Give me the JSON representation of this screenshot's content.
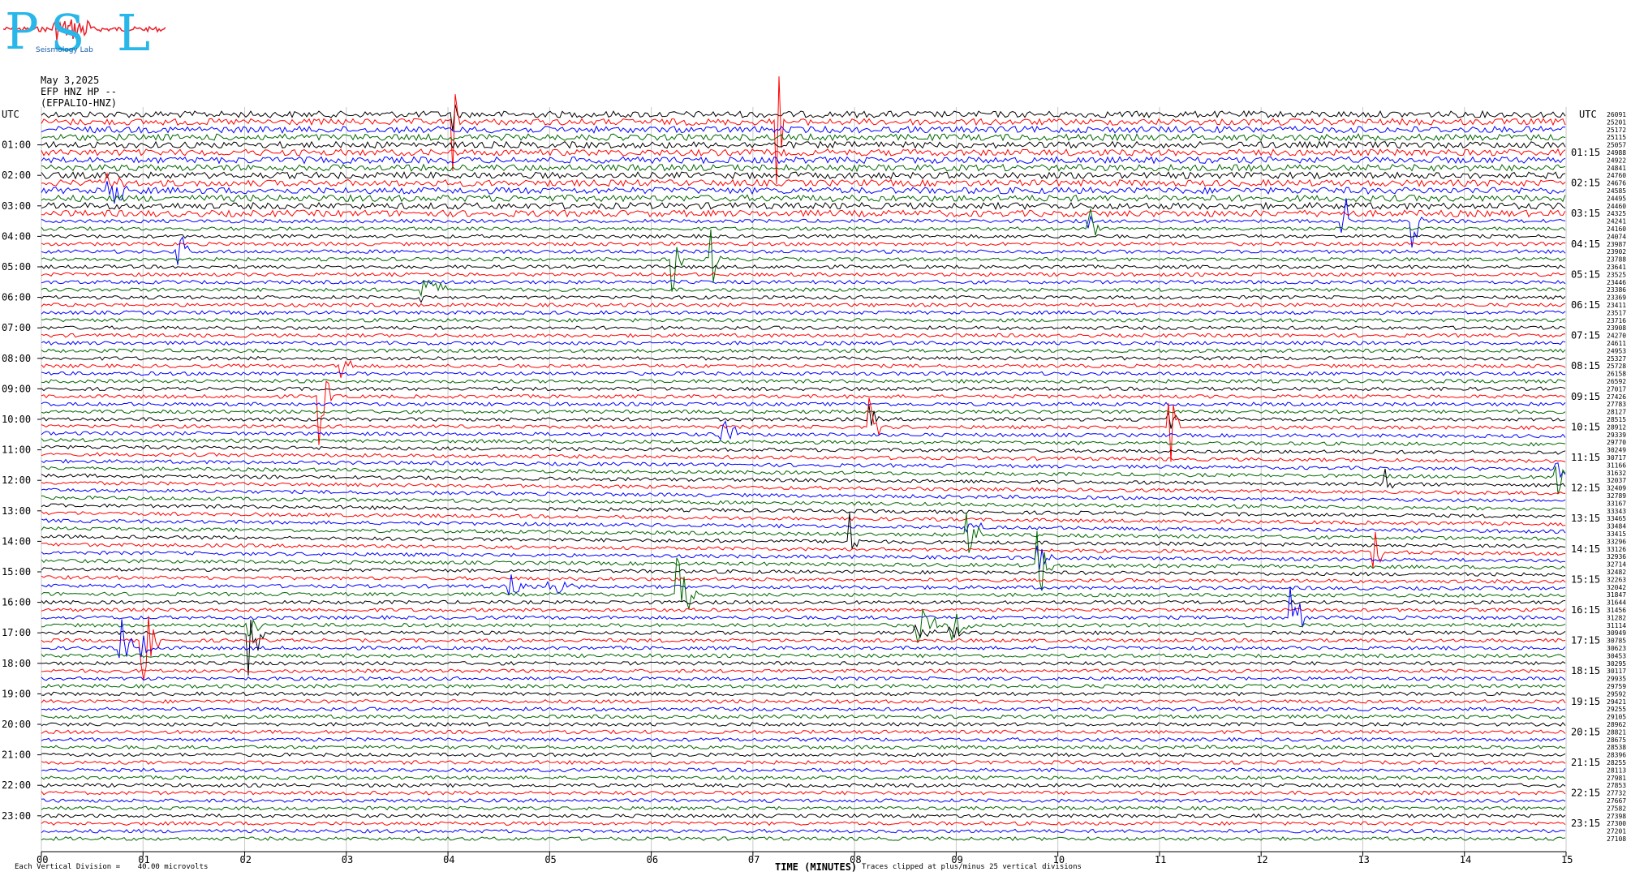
{
  "logo": {
    "letters": [
      "P",
      "S",
      "L"
    ],
    "tagline": "Seismology Lab",
    "letter_color": "#29b6e8",
    "accent_color": "#e8202a"
  },
  "header": {
    "date": "May 3,2025",
    "channel": "EFP HNZ HP --",
    "station": "(EFPALIO-HNZ)"
  },
  "footer": {
    "scale_note": "Each Vertical Division =    40.00 microvolts",
    "clip_note": "Traces clipped at plus/minus 25 vertical divisions",
    "x_axis_title": "TIME (MINUTES)"
  },
  "chart_data": {
    "type": "line",
    "title": "",
    "xlabel": "TIME (MINUTES)",
    "xlim": [
      0,
      15
    ],
    "x_ticks": [
      "00",
      "01",
      "02",
      "03",
      "04",
      "05",
      "06",
      "07",
      "08",
      "09",
      "10",
      "11",
      "12",
      "13",
      "14",
      "15"
    ],
    "left_axis_label": "UTC",
    "right_axis_label": "UTC",
    "left_hour_labels": [
      "01:00",
      "02:00",
      "03:00",
      "04:00",
      "05:00",
      "06:00",
      "07:00",
      "08:00",
      "09:00",
      "10:00",
      "11:00",
      "12:00",
      "13:00",
      "14:00",
      "15:00",
      "16:00",
      "17:00",
      "18:00",
      "19:00",
      "20:00",
      "21:00",
      "22:00",
      "23:00"
    ],
    "right_hour_labels": [
      "01:15",
      "02:15",
      "03:15",
      "04:15",
      "05:15",
      "06:15",
      "07:15",
      "08:15",
      "09:15",
      "10:15",
      "11:15",
      "12:15",
      "13:15",
      "14:15",
      "15:15",
      "16:15",
      "17:15",
      "18:15",
      "19:15",
      "20:15",
      "21:15",
      "22:15",
      "23:15"
    ],
    "trace_count": 96,
    "trace_minutes": 15,
    "trace_colors": [
      "#000000",
      "#ff0000",
      "#0000ff",
      "#006600"
    ],
    "grid": "vertical lines at each minute",
    "right_offsets": [
      "26091",
      "25201",
      "25172",
      "25115",
      "25057",
      "24988",
      "24922",
      "24841",
      "24760",
      "24676",
      "24585",
      "24495",
      "24460",
      "24325",
      "24241",
      "24160",
      "24074",
      "23987",
      "23902",
      "23788",
      "23641",
      "23525",
      "23446",
      "23386",
      "23369",
      "23411",
      "23517",
      "23716",
      "23908",
      "24270",
      "24611",
      "24953",
      "25327",
      "25728",
      "26158",
      "26592",
      "27017",
      "27426",
      "27783",
      "28127",
      "28515",
      "28912",
      "29339",
      "29770",
      "30249",
      "30717",
      "31166",
      "31632",
      "32037",
      "32409",
      "32789",
      "33167",
      "33343",
      "33465",
      "33484",
      "33415",
      "33296",
      "33126",
      "32936",
      "32714",
      "32482",
      "32263",
      "32042",
      "31847",
      "31644",
      "31456",
      "31282",
      "31114",
      "30949",
      "30785",
      "30623",
      "30453",
      "30295",
      "30117",
      "29935",
      "29759",
      "29592",
      "29421",
      "29255",
      "29105",
      "28962",
      "28821",
      "28675",
      "28538",
      "28396",
      "28255",
      "28113",
      "27981",
      "27853",
      "27732",
      "27667",
      "27582",
      "27398",
      "27300",
      "27201",
      "27108"
    ],
    "events": [
      {
        "minute": 0.65,
        "hour": 2.6,
        "amp": 38,
        "color_index": 1,
        "duration": 0.25
      },
      {
        "minute": 4.05,
        "hour": 0.3,
        "amp": 70,
        "color_index": 0,
        "duration": 0.05
      },
      {
        "minute": 7.25,
        "hour": 0.3,
        "amp": 80,
        "color_index": 3,
        "duration": 0.05
      },
      {
        "minute": 1.35,
        "hour": 4.5,
        "amp": 40,
        "color_index": 3,
        "duration": 0.1
      },
      {
        "minute": 3.75,
        "hour": 5.85,
        "amp": 20,
        "color_index": 0,
        "duration": 0.3
      },
      {
        "minute": 6.2,
        "hour": 4.7,
        "amp": 45,
        "color_index": 3,
        "duration": 0.1
      },
      {
        "minute": 6.6,
        "hour": 4.7,
        "amp": 40,
        "color_index": 3,
        "duration": 0.1
      },
      {
        "minute": 2.75,
        "hour": 9.2,
        "amp": 60,
        "color_index": 3,
        "duration": 0.1
      },
      {
        "minute": 2.95,
        "hour": 8.3,
        "amp": 45,
        "color_index": 3,
        "duration": 0.1
      },
      {
        "minute": 6.7,
        "hour": 10.5,
        "amp": 50,
        "color_index": 2,
        "duration": 0.15
      },
      {
        "minute": 8.15,
        "hour": 10.3,
        "amp": 55,
        "color_index": 0,
        "duration": 0.1
      },
      {
        "minute": 11.1,
        "hour": 10.2,
        "amp": 55,
        "color_index": 0,
        "duration": 0.1
      },
      {
        "minute": 12.8,
        "hour": 3.6,
        "amp": 60,
        "color_index": 0,
        "duration": 0.1
      },
      {
        "minute": 13.5,
        "hour": 3.4,
        "amp": 45,
        "color_index": 2,
        "duration": 0.1
      },
      {
        "minute": 10.3,
        "hour": 3.7,
        "amp": 35,
        "color_index": 2,
        "duration": 0.1
      },
      {
        "minute": 14.9,
        "hour": 11.7,
        "amp": 55,
        "color_index": 2,
        "duration": 0.15
      },
      {
        "minute": 13.2,
        "hour": 12.0,
        "amp": 40,
        "color_index": 2,
        "duration": 0.1
      },
      {
        "minute": 9.1,
        "hour": 13.8,
        "amp": 35,
        "color_index": 2,
        "duration": 0.2
      },
      {
        "minute": 9.8,
        "hour": 14.8,
        "amp": 55,
        "color_index": 2,
        "duration": 0.15
      },
      {
        "minute": 7.95,
        "hour": 14.0,
        "amp": 40,
        "color_index": 2,
        "duration": 0.1
      },
      {
        "minute": 6.25,
        "hour": 15.7,
        "amp": 50,
        "color_index": 3,
        "duration": 0.2
      },
      {
        "minute": 12.3,
        "hour": 16.4,
        "amp": 55,
        "color_index": 0,
        "duration": 0.15
      },
      {
        "minute": 0.75,
        "hour": 17.4,
        "amp": 55,
        "color_index": 0,
        "duration": 0.15
      },
      {
        "minute": 1.0,
        "hour": 17.2,
        "amp": 55,
        "color_index": 2,
        "duration": 0.15
      },
      {
        "minute": 2.05,
        "hour": 17.0,
        "amp": 55,
        "color_index": 3,
        "duration": 0.15
      },
      {
        "minute": 8.6,
        "hour": 16.8,
        "amp": 30,
        "color_index": 0,
        "duration": 0.25
      },
      {
        "minute": 8.95,
        "hour": 16.8,
        "amp": 25,
        "color_index": 0,
        "duration": 0.2
      },
      {
        "minute": 13.1,
        "hour": 14.2,
        "amp": 40,
        "color_index": 3,
        "duration": 0.1
      },
      {
        "minute": 4.6,
        "hour": 15.5,
        "amp": 18,
        "color_index": 0,
        "duration": 0.2
      },
      {
        "minute": 5.0,
        "hour": 15.5,
        "amp": 12,
        "color_index": 0,
        "duration": 0.3
      }
    ]
  }
}
